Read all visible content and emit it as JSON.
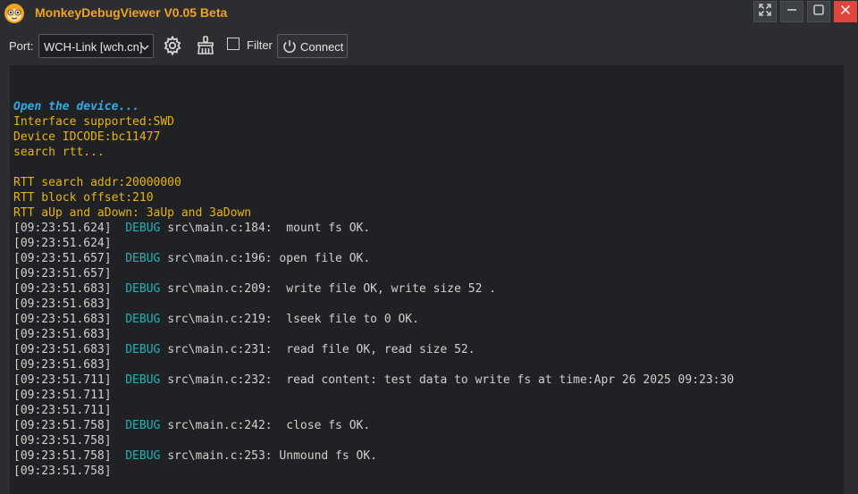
{
  "window": {
    "title": "MonkeyDebugViewer V0.05 Beta",
    "accent_color": "#f0a31e",
    "close_color": "#e0463d"
  },
  "toolbar": {
    "port_label": "Port:",
    "port_value": "WCH-Link [wch.cn]",
    "filter_label": "Filter",
    "filter_checked": false,
    "connect_label": "Connect"
  },
  "console": {
    "header_lines": [
      {
        "text": "Open the device...",
        "style": "highlight"
      },
      {
        "text": "Interface supported:SWD",
        "style": "info"
      },
      {
        "text": "Device IDCODE:bc11477",
        "style": "info"
      },
      {
        "text": "search rtt...",
        "style": "info"
      },
      {
        "text": "",
        "style": "info"
      },
      {
        "text": "RTT search addr:20000000",
        "style": "info"
      },
      {
        "text": "RTT block offset:210",
        "style": "info"
      },
      {
        "text": "RTT aUp and aDown: 3aUp and 3aDown",
        "style": "info"
      }
    ],
    "log_lines": [
      {
        "ts": "[09:23:51.624]",
        "level": "DEBUG",
        "msg": "src\\main.c:184:  mount fs OK."
      },
      {
        "ts": "[09:23:51.624]",
        "level": "",
        "msg": ""
      },
      {
        "ts": "[09:23:51.657]",
        "level": "DEBUG",
        "msg": "src\\main.c:196: open file OK."
      },
      {
        "ts": "[09:23:51.657]",
        "level": "",
        "msg": ""
      },
      {
        "ts": "[09:23:51.683]",
        "level": "DEBUG",
        "msg": "src\\main.c:209:  write file OK, write size 52 ."
      },
      {
        "ts": "[09:23:51.683]",
        "level": "",
        "msg": ""
      },
      {
        "ts": "[09:23:51.683]",
        "level": "DEBUG",
        "msg": "src\\main.c:219:  lseek file to 0 OK."
      },
      {
        "ts": "[09:23:51.683]",
        "level": "",
        "msg": ""
      },
      {
        "ts": "[09:23:51.683]",
        "level": "DEBUG",
        "msg": "src\\main.c:231:  read file OK, read size 52."
      },
      {
        "ts": "[09:23:51.683]",
        "level": "",
        "msg": ""
      },
      {
        "ts": "[09:23:51.711]",
        "level": "DEBUG",
        "msg": "src\\main.c:232:  read content: test data to write fs at time:Apr 26 2025 09:23:30"
      },
      {
        "ts": "[09:23:51.711]",
        "level": "",
        "msg": ""
      },
      {
        "ts": "[09:23:51.711]",
        "level": "",
        "msg": ""
      },
      {
        "ts": "[09:23:51.758]",
        "level": "DEBUG",
        "msg": "src\\main.c:242:  close fs OK."
      },
      {
        "ts": "[09:23:51.758]",
        "level": "",
        "msg": ""
      },
      {
        "ts": "[09:23:51.758]",
        "level": "DEBUG",
        "msg": "src\\main.c:253: Unmound fs OK."
      },
      {
        "ts": "[09:23:51.758]",
        "level": "",
        "msg": ""
      }
    ],
    "colors": {
      "highlight": "#35a9e2",
      "info": "#e8b50d",
      "debug": "#1fb3b3",
      "text": "#d0d0d0",
      "background": "#1f2124"
    }
  }
}
